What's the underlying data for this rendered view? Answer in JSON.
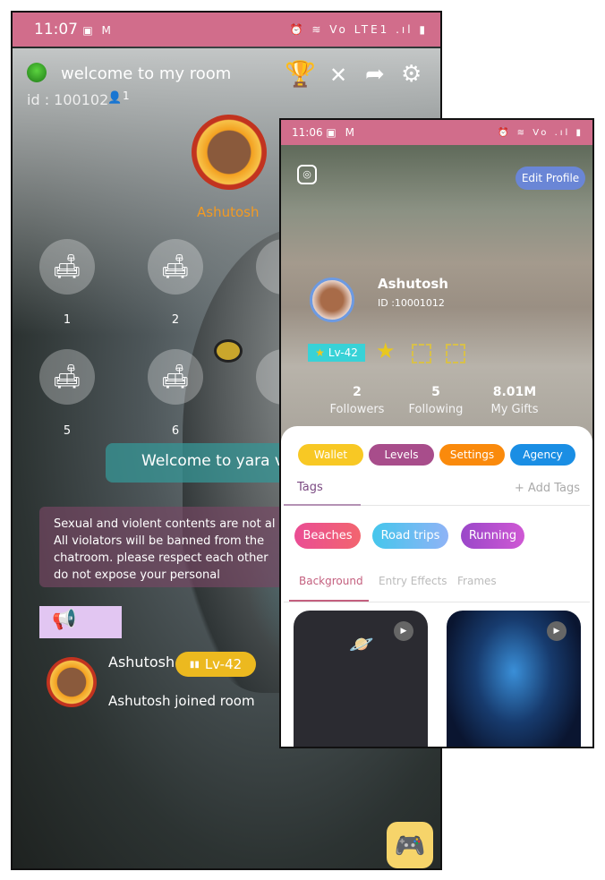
{
  "room_screen": {
    "status_bar": {
      "time": "11:07",
      "icons": "▣ M",
      "right_icons": "⏰ ≋ Vo LTE1 .ıl ▮"
    },
    "room_title": "welcome to my room",
    "room_id": "id : 100102",
    "online_count": "1",
    "host_name": "Ashutosh",
    "seats": [
      {
        "label": "1"
      },
      {
        "label": "2"
      },
      {
        "label": "5"
      },
      {
        "label": "6"
      }
    ],
    "welcome_banner": "Welcome to yara v",
    "notice_lines": [
      "Sexual and violent contents are not al",
      "All violators will be banned from the",
      "chatroom. please respect each other",
      "do not expose your personal"
    ],
    "message": {
      "user": "Ashutosh",
      "level": "Lv-42",
      "text": "Ashutosh joined room"
    }
  },
  "profile_screen": {
    "status_bar": {
      "time": "11:06",
      "icons": "▣ M",
      "right_icons": "⏰ ≋ Vo .ıl ▮"
    },
    "edit_profile": "Edit Profile",
    "name": "Ashutosh",
    "id": "ID :10001012",
    "level": "Lv-42",
    "stats": [
      {
        "value": "2",
        "label": "Followers"
      },
      {
        "value": "5",
        "label": "Following"
      },
      {
        "value": "8.01M",
        "label": "My Gifts"
      }
    ],
    "actions": [
      {
        "label": "Wallet",
        "color": "#f8c824"
      },
      {
        "label": "Levels",
        "color": "#a84d8b"
      },
      {
        "label": "Settings",
        "color": "#fa8a0c"
      },
      {
        "label": "Agency",
        "color": "#1a8ee4"
      }
    ],
    "tags_tab": "Tags",
    "add_tags": "+ Add Tags",
    "tags": [
      {
        "label": "Beaches"
      },
      {
        "label": "Road trips"
      },
      {
        "label": "Running"
      }
    ],
    "media_tabs": [
      {
        "label": "Background",
        "active": true
      },
      {
        "label": "Entry Effects"
      },
      {
        "label": "Frames"
      }
    ]
  }
}
